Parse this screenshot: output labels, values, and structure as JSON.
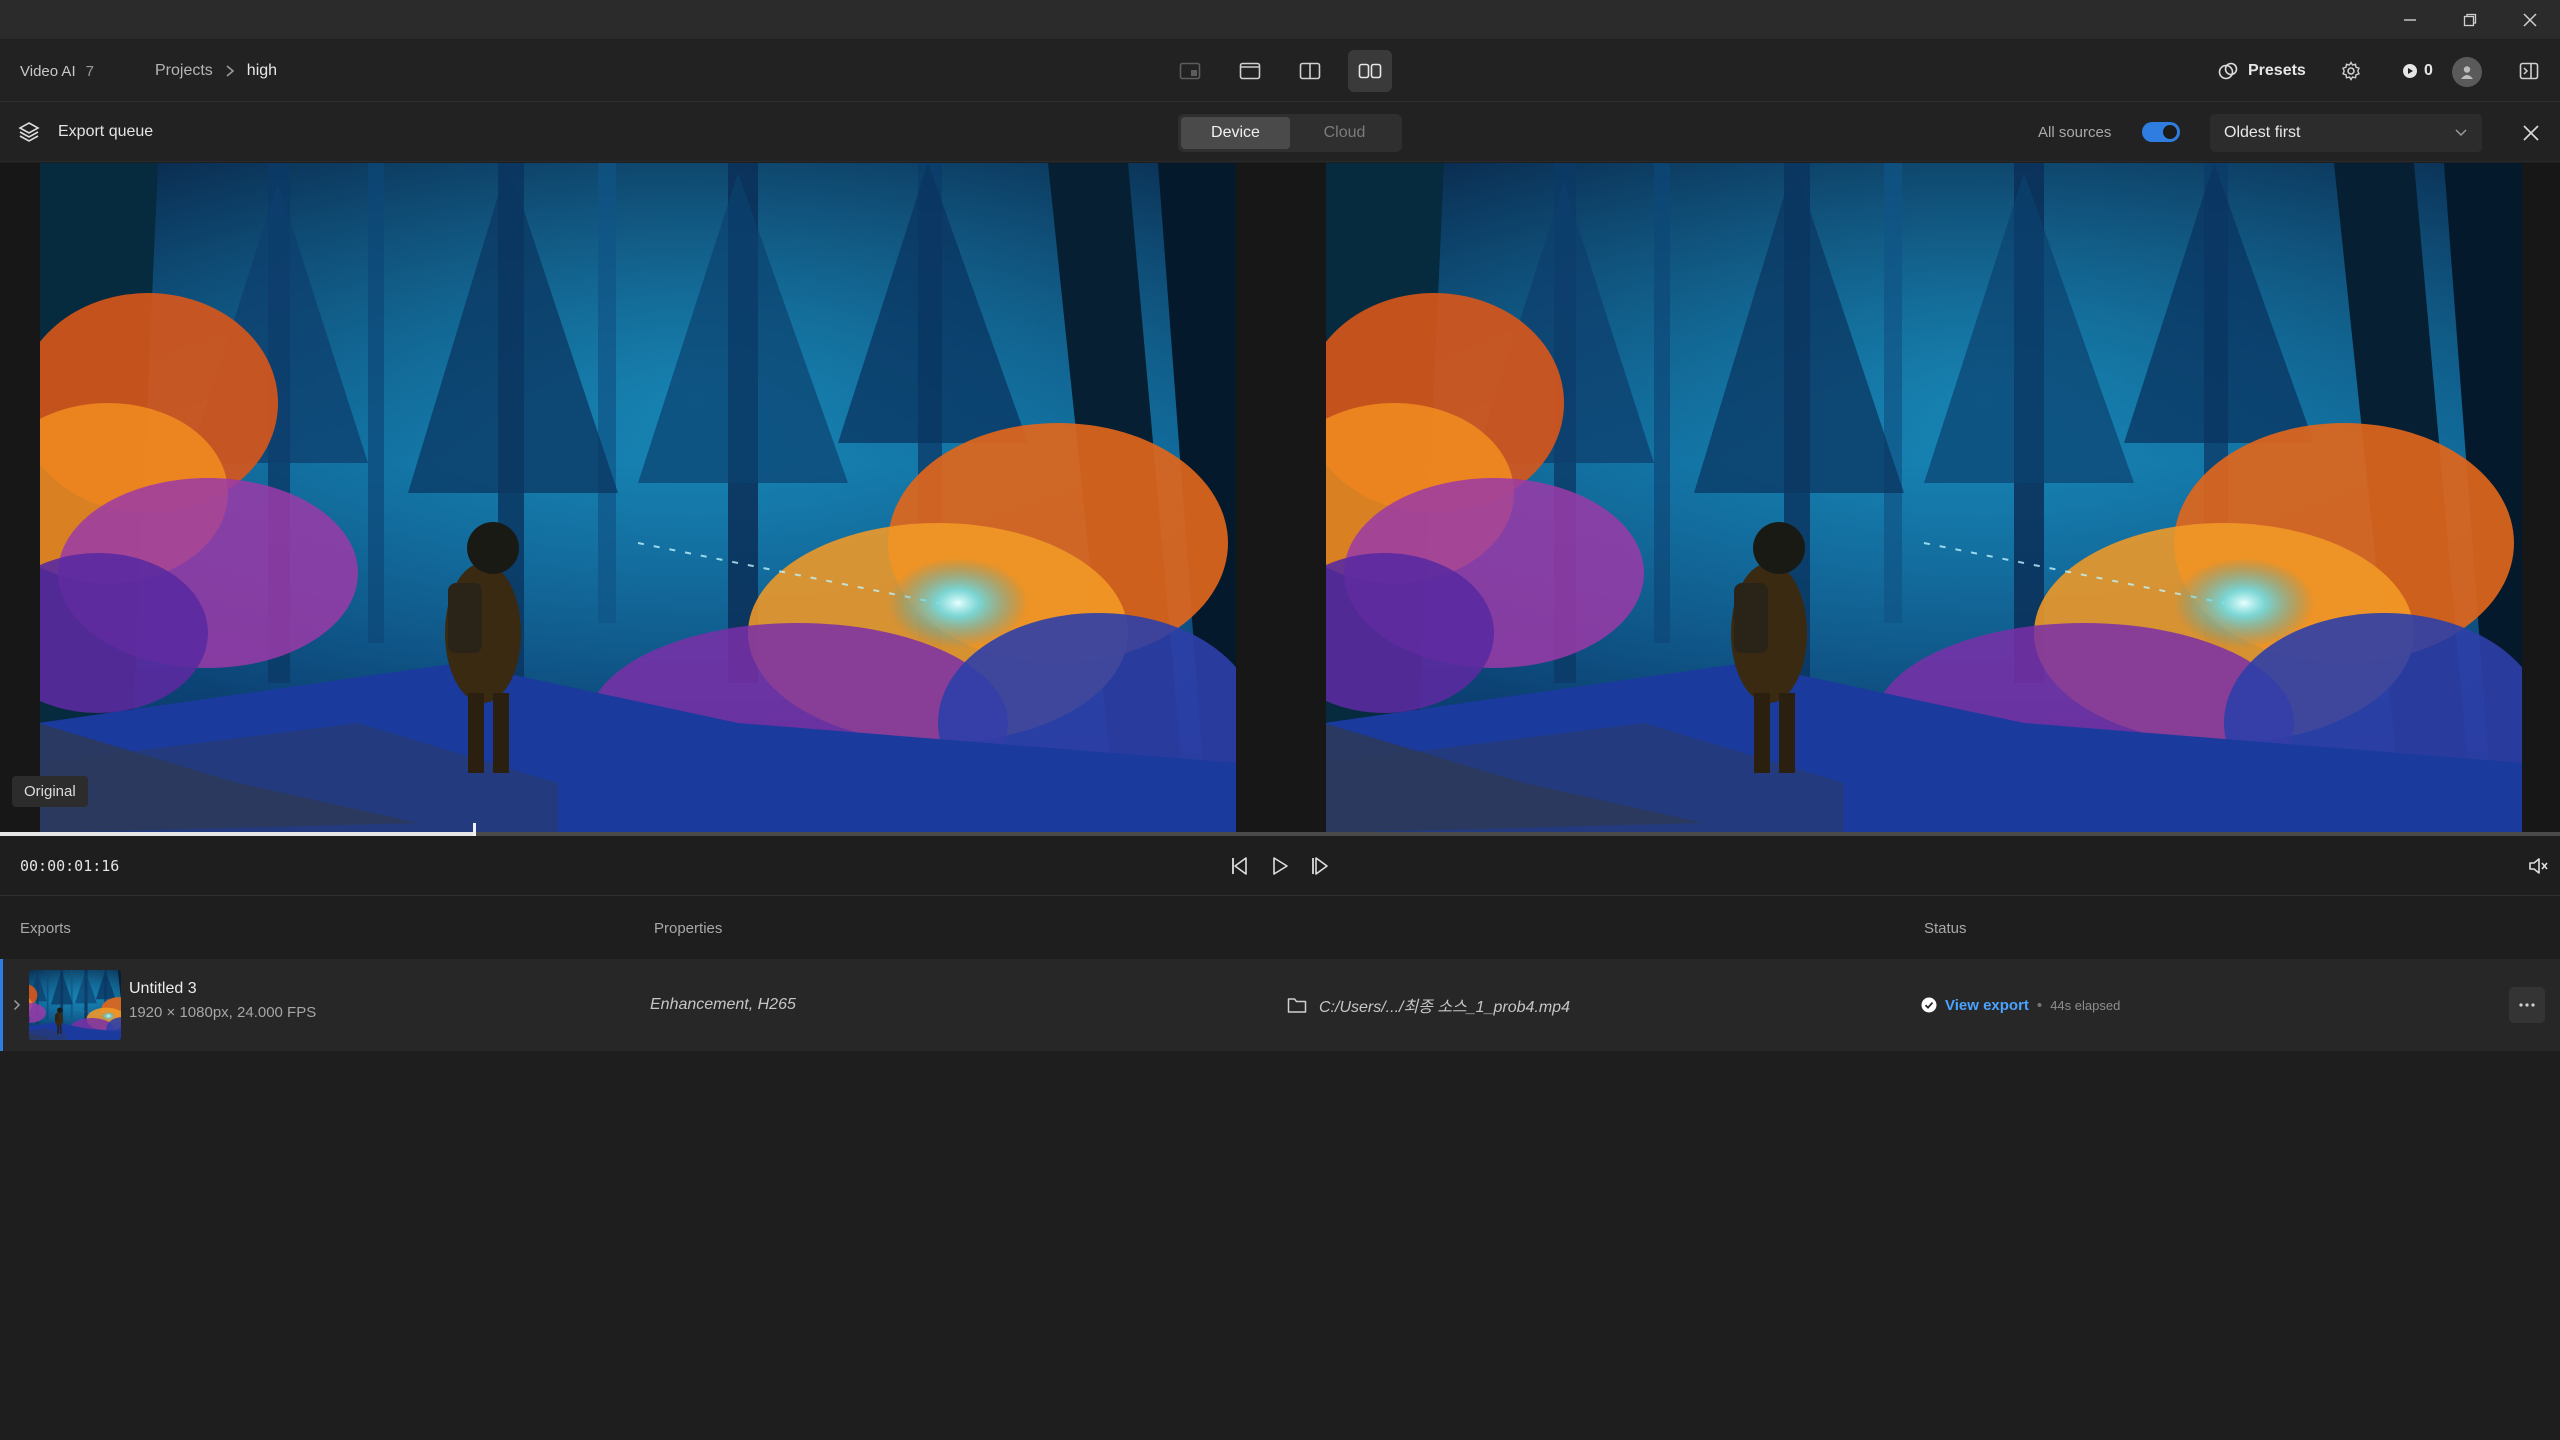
{
  "app": {
    "name": "Video AI",
    "version": "7"
  },
  "breadcrumb": {
    "parent": "Projects",
    "current": "high"
  },
  "header": {
    "presets_label": "Presets",
    "credits": "0"
  },
  "queue": {
    "title": "Export queue",
    "tabs": [
      "Device",
      "Cloud"
    ],
    "active_tab": "Device",
    "all_sources_label": "All sources",
    "all_sources_on": true,
    "sort_value": "Oldest first"
  },
  "preview": {
    "original_label": "Original",
    "timecode": "00:00:01:16",
    "progress": 0.185
  },
  "table": {
    "headers": {
      "exports": "Exports",
      "properties": "Properties",
      "status": "Status"
    },
    "rows": [
      {
        "title": "Untitled 3",
        "details": "1920 × 1080px, 24.000 FPS",
        "properties": "Enhancement, H265",
        "path": "C:/Users/.../최종 소스_1_prob4.mp4",
        "status_link": "View export",
        "separator": "•",
        "elapsed": "44s elapsed"
      }
    ]
  },
  "colors": {
    "accent": "#2f7de0",
    "link": "#4aa3ff",
    "background": "#1e1e1e"
  },
  "icons": [
    "minimize-icon",
    "restore-icon",
    "close-icon",
    "chevron-right-icon",
    "single-view-icon",
    "compare-view-icon",
    "split-view-icon",
    "side-by-side-view-icon",
    "presets-icon",
    "gear-icon",
    "credit-icon",
    "user-icon",
    "panel-icon",
    "layers-icon",
    "chevron-down-icon",
    "prev-frame-icon",
    "play-icon",
    "next-frame-icon",
    "mute-icon",
    "folder-icon",
    "check-circle-icon",
    "more-icon"
  ]
}
